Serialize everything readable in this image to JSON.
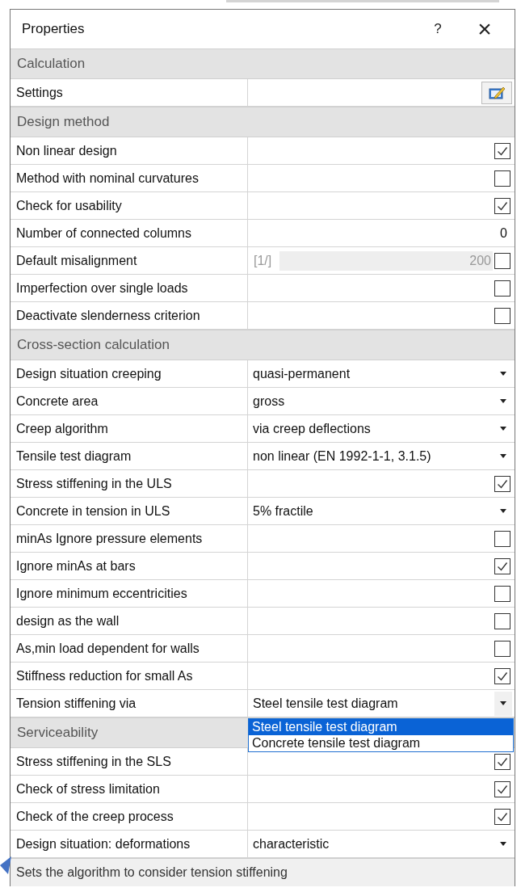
{
  "window": {
    "title": "Properties",
    "help": "?",
    "close": "×"
  },
  "sections": [
    {
      "title": "Calculation",
      "rows": [
        {
          "kind": "button",
          "label": "Settings"
        }
      ]
    },
    {
      "title": "Design method",
      "rows": [
        {
          "kind": "check",
          "label": "Non linear design",
          "checked": true
        },
        {
          "kind": "check",
          "label": "Method with nominal curvatures",
          "checked": false
        },
        {
          "kind": "check",
          "label": "Check for usability",
          "checked": true
        },
        {
          "kind": "number",
          "label": "Number of connected columns",
          "value": "0"
        },
        {
          "kind": "ratio",
          "label": "Default misalignment",
          "prefix": "[1/]",
          "value": "200",
          "checked": false,
          "disabled": true
        },
        {
          "kind": "check",
          "label": "Imperfection over single loads",
          "checked": false
        },
        {
          "kind": "check",
          "label": "Deactivate slenderness criterion",
          "checked": false
        }
      ]
    },
    {
      "title": "Cross-section calculation",
      "rows": [
        {
          "kind": "combo",
          "label": "Design situation creeping",
          "value": "quasi-permanent"
        },
        {
          "kind": "combo",
          "label": "Concrete area",
          "value": "gross"
        },
        {
          "kind": "combo",
          "label": "Creep algorithm",
          "value": "via creep deflections"
        },
        {
          "kind": "combo",
          "label": "Tensile test diagram",
          "value": "non linear (EN 1992-1-1, 3.1.5)"
        },
        {
          "kind": "check",
          "label": "Stress stiffening in the ULS",
          "checked": true
        },
        {
          "kind": "combo",
          "label": "Concrete in tension in ULS",
          "value": "5% fractile"
        },
        {
          "kind": "check",
          "label": "minAs Ignore pressure elements",
          "checked": false
        },
        {
          "kind": "check",
          "label": "Ignore minAs at bars",
          "checked": true
        },
        {
          "kind": "check",
          "label": "Ignore minimum eccentricities",
          "checked": false
        },
        {
          "kind": "check",
          "label": "design as the wall",
          "checked": false
        },
        {
          "kind": "check",
          "label": "As,min load dependent for walls",
          "checked": false
        },
        {
          "kind": "check",
          "label": "Stiffness reduction for small As",
          "checked": true
        },
        {
          "kind": "combo",
          "label": "Tension stiffening via",
          "value": "Steel tensile test diagram",
          "open": true
        }
      ]
    },
    {
      "title": "Serviceability",
      "rows": [
        {
          "kind": "check",
          "label": "Stress stiffening in the SLS",
          "checked": true
        },
        {
          "kind": "check",
          "label": "Check of stress limitation",
          "checked": true
        },
        {
          "kind": "check",
          "label": "Check of the creep process",
          "checked": true
        },
        {
          "kind": "combo",
          "label": "Design situation: deformations",
          "value": "characteristic"
        }
      ]
    }
  ],
  "dropdown": {
    "options": [
      {
        "label": "Steel tensile test diagram",
        "selected": true
      },
      {
        "label": "Concrete tensile test diagram",
        "selected": false
      }
    ]
  },
  "description": "Sets the algorithm to consider tension stiffening"
}
